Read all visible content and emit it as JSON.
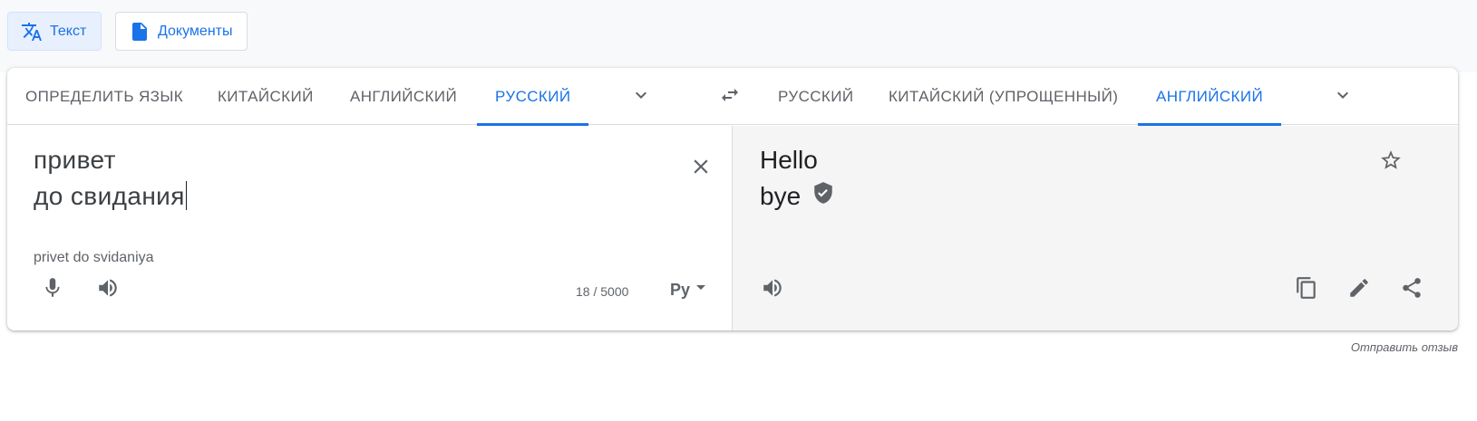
{
  "modes": {
    "text_label": "Текст",
    "documents_label": "Документы"
  },
  "source_languages": {
    "tabs": [
      "Определить язык",
      "Китайский",
      "Английский",
      "Русский"
    ],
    "active": "Русский"
  },
  "target_languages": {
    "tabs": [
      "Русский",
      "Китайский (упрощенный)",
      "Английский"
    ],
    "active": "Английский"
  },
  "source": {
    "lines": [
      "привет",
      "до свидания"
    ],
    "transliteration": "privet do svidaniya",
    "char_count": "18 / 5000",
    "keyboard_label": "Ру"
  },
  "target": {
    "lines": [
      "Hello",
      "bye"
    ]
  },
  "feedback_label": "Отправить отзыв",
  "icons": [
    "translate-icon",
    "document-icon",
    "chevron-down-icon",
    "swap-icon",
    "close-icon",
    "microphone-icon",
    "speaker-icon",
    "keyboard-icon",
    "star-icon",
    "verified-shield-icon",
    "copy-icon",
    "edit-icon",
    "share-icon"
  ],
  "colors": {
    "accent": "#1a73e8",
    "text_secondary": "#5f6368",
    "target_background": "#f5f5f5",
    "active_mode_background": "#e8f0fe"
  }
}
